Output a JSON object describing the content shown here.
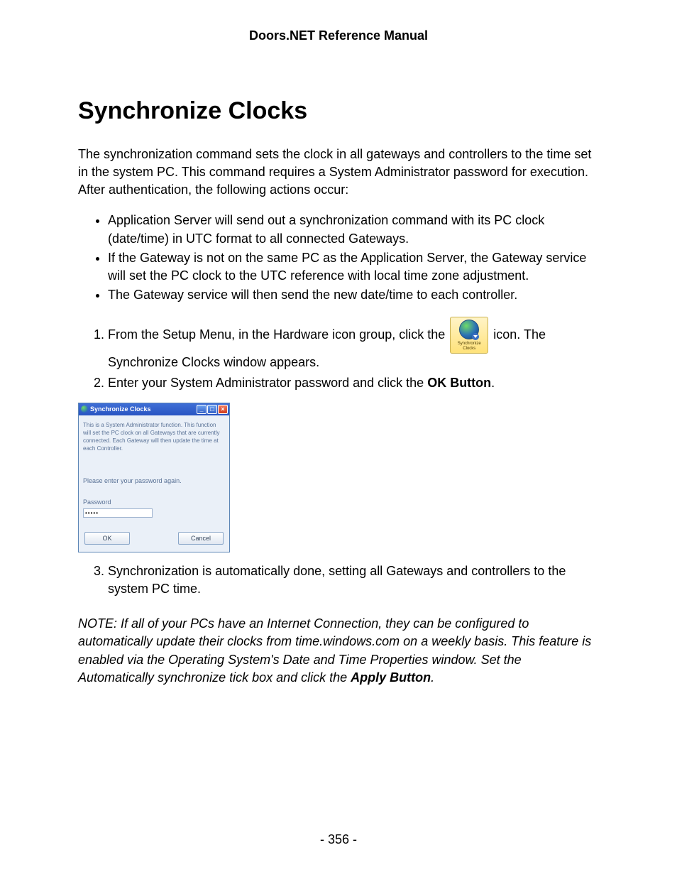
{
  "header": "Doors.NET Reference Manual",
  "title": "Synchronize Clocks",
  "intro": "The synchronization command sets the clock in all gateways and controllers to the time set in the system PC. This command requires a System Administrator password for execution. After authentication, the following actions occur:",
  "bullets": [
    "Application Server will send out a synchronization command with its PC clock (date/time) in UTC format to all connected Gateways.",
    "If the Gateway is not on the same PC as the Application Server, the Gateway service will set the PC clock to the UTC reference with local time zone adjustment.",
    "The Gateway service will then send the new date/time to each controller."
  ],
  "step1_pre": "From the Setup Menu, in the Hardware icon group, click the",
  "step1_post": "icon. The Synchronize Clocks window appears.",
  "syncIcon": {
    "line1": "Synchronize",
    "line2": "Clocks"
  },
  "step2_pre": "Enter your System Administrator password and click the ",
  "step2_bold": "OK Button",
  "step2_post": ".",
  "dialog": {
    "title": "Synchronize Clocks",
    "desc": "This is a System Administrator function.  This function will set the PC clock on all Gateways that are currently connected.  Each Gateway will then update the time at each Controller.",
    "prompt": "Please enter your password again.",
    "pwLabel": "Password",
    "pwValue": "•••••",
    "ok": "OK",
    "cancel": "Cancel"
  },
  "step3": "Synchronization is automatically done, setting all Gateways and controllers to the system PC time.",
  "note_pre": "NOTE: If all of your PCs have an Internet Connection, they can be configured to automatically update their clocks from time.windows.com on a weekly basis. This feature is enabled via the Operating System's Date and Time Properties window. Set the Automatically synchronize tick box and click the ",
  "note_bold": "Apply Button",
  "note_post": ".",
  "pageNumber": "- 356 -"
}
